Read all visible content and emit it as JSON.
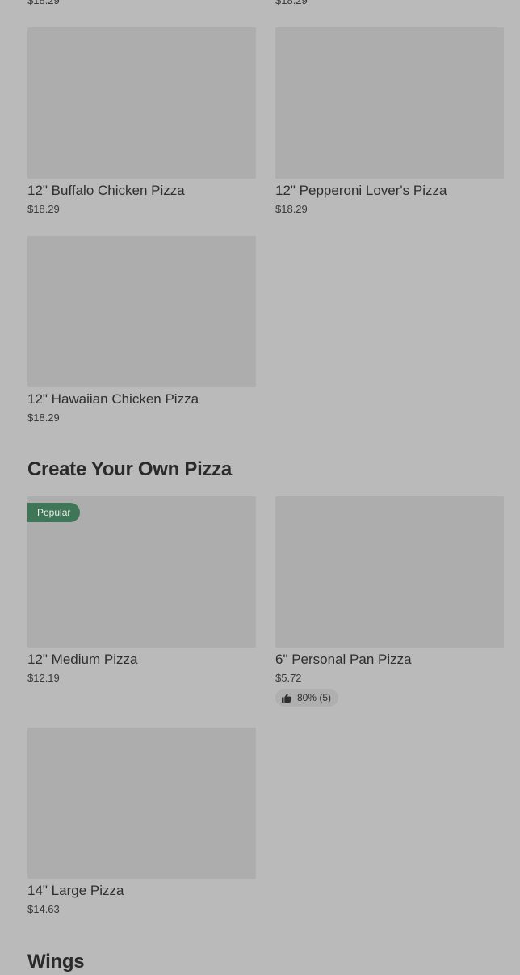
{
  "sections": [
    {
      "title": null,
      "items": [
        {
          "name": null,
          "price": "$18.29"
        },
        {
          "name": null,
          "price": "$18.29"
        },
        {
          "name": "12\" Buffalo Chicken Pizza",
          "price": "$18.29"
        },
        {
          "name": "12\" Pepperoni Lover's Pizza",
          "price": "$18.29"
        },
        {
          "name": "12\" Hawaiian Chicken Pizza",
          "price": "$18.29"
        }
      ]
    },
    {
      "title": "Create Your Own Pizza",
      "items": [
        {
          "name": "12\" Medium Pizza",
          "price": "$12.19",
          "badge": "Popular"
        },
        {
          "name": "6\" Personal Pan Pizza",
          "price": "$5.72",
          "rating": "80% (5)",
          "rating_icon": "thumbs-up-icon"
        },
        {
          "name": "14\" Large Pizza",
          "price": "$14.63"
        }
      ]
    },
    {
      "title": "Wings",
      "items": []
    }
  ],
  "colors": {
    "background": "#bababa",
    "image_placeholder": "#adadad",
    "badge": "#3f7657",
    "rating_pill": "#afafaf"
  }
}
